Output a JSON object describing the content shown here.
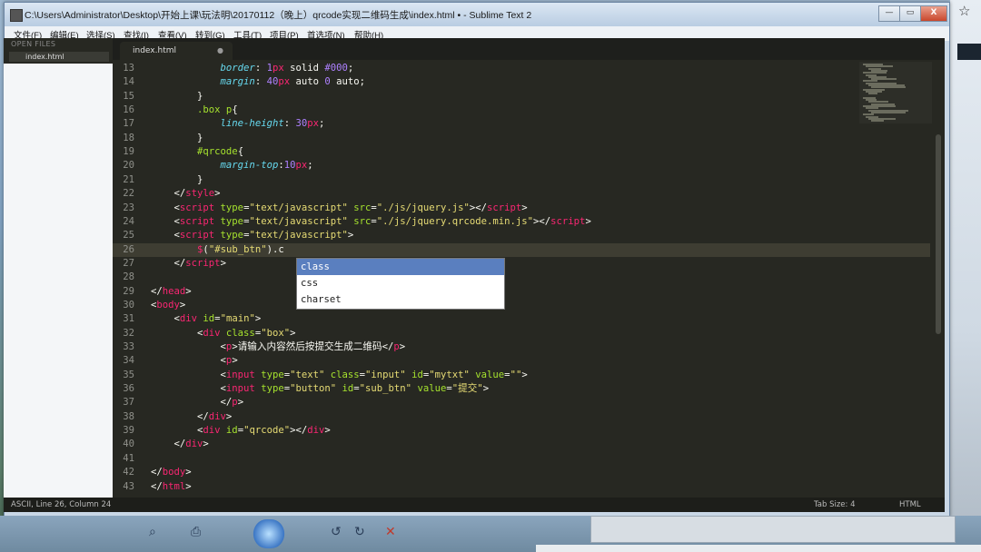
{
  "window": {
    "title": "C:\\Users\\Administrator\\Desktop\\开始上课\\玩法明\\20170112（晚上）qrcode实现二维码生成\\index.html • - Sublime Text 2",
    "controls": {
      "minimize": "—",
      "maximize": "▭",
      "close": "X"
    }
  },
  "menu": [
    "文件(F)",
    "编辑(E)",
    "选择(S)",
    "查找(I)",
    "查看(V)",
    "转到(G)",
    "工具(T)",
    "项目(P)",
    "首选项(N)",
    "帮助(H)"
  ],
  "sidebar": {
    "header": "OPEN FILES",
    "open_file": "index.html"
  },
  "editor": {
    "tab": {
      "label": "index.html",
      "dirty_icon": "●"
    },
    "current_line": 26,
    "lines": [
      {
        "n": "13",
        "tokens": [
          {
            "t": "            ",
            "c": "pun"
          },
          {
            "t": "border",
            "c": "prop"
          },
          {
            "t": ": ",
            "c": "pun"
          },
          {
            "t": "1",
            "c": "num"
          },
          {
            "t": "px",
            "c": "unit"
          },
          {
            "t": " solid ",
            "c": "text"
          },
          {
            "t": "#000",
            "c": "num"
          },
          {
            "t": ";",
            "c": "pun"
          }
        ]
      },
      {
        "n": "14",
        "tokens": [
          {
            "t": "            ",
            "c": "pun"
          },
          {
            "t": "margin",
            "c": "prop"
          },
          {
            "t": ": ",
            "c": "pun"
          },
          {
            "t": "40",
            "c": "num"
          },
          {
            "t": "px",
            "c": "unit"
          },
          {
            "t": " auto ",
            "c": "text"
          },
          {
            "t": "0",
            "c": "num"
          },
          {
            "t": " auto;",
            "c": "text"
          }
        ]
      },
      {
        "n": "15",
        "tokens": [
          {
            "t": "        }",
            "c": "pun"
          }
        ]
      },
      {
        "n": "16",
        "tokens": [
          {
            "t": "        ",
            "c": "pun"
          },
          {
            "t": ".box p",
            "c": "sel"
          },
          {
            "t": "{",
            "c": "pun"
          }
        ]
      },
      {
        "n": "17",
        "tokens": [
          {
            "t": "            ",
            "c": "pun"
          },
          {
            "t": "line-height",
            "c": "prop"
          },
          {
            "t": ": ",
            "c": "pun"
          },
          {
            "t": "30",
            "c": "num"
          },
          {
            "t": "px",
            "c": "unit"
          },
          {
            "t": ";",
            "c": "pun"
          }
        ]
      },
      {
        "n": "18",
        "tokens": [
          {
            "t": "        }",
            "c": "pun"
          }
        ]
      },
      {
        "n": "19",
        "tokens": [
          {
            "t": "        ",
            "c": "pun"
          },
          {
            "t": "#qrcode",
            "c": "sel"
          },
          {
            "t": "{",
            "c": "pun"
          }
        ]
      },
      {
        "n": "20",
        "tokens": [
          {
            "t": "            ",
            "c": "pun"
          },
          {
            "t": "margin-top",
            "c": "prop"
          },
          {
            "t": ":",
            "c": "pun"
          },
          {
            "t": "10",
            "c": "num"
          },
          {
            "t": "px",
            "c": "unit"
          },
          {
            "t": ";",
            "c": "pun"
          }
        ]
      },
      {
        "n": "21",
        "tokens": [
          {
            "t": "        }",
            "c": "pun"
          }
        ]
      },
      {
        "n": "22",
        "tokens": [
          {
            "t": "    </",
            "c": "pun"
          },
          {
            "t": "style",
            "c": "tag"
          },
          {
            "t": ">",
            "c": "pun"
          }
        ]
      },
      {
        "n": "23",
        "tokens": [
          {
            "t": "    <",
            "c": "pun"
          },
          {
            "t": "script",
            "c": "tag"
          },
          {
            "t": " type",
            "c": "attr"
          },
          {
            "t": "=",
            "c": "pun"
          },
          {
            "t": "\"text/javascript\"",
            "c": "str"
          },
          {
            "t": " src",
            "c": "attr"
          },
          {
            "t": "=",
            "c": "pun"
          },
          {
            "t": "\"./js/jquery.js\"",
            "c": "str"
          },
          {
            "t": "></",
            "c": "pun"
          },
          {
            "t": "script",
            "c": "tag"
          },
          {
            "t": ">",
            "c": "pun"
          }
        ]
      },
      {
        "n": "24",
        "tokens": [
          {
            "t": "    <",
            "c": "pun"
          },
          {
            "t": "script",
            "c": "tag"
          },
          {
            "t": " type",
            "c": "attr"
          },
          {
            "t": "=",
            "c": "pun"
          },
          {
            "t": "\"text/javascript\"",
            "c": "str"
          },
          {
            "t": " src",
            "c": "attr"
          },
          {
            "t": "=",
            "c": "pun"
          },
          {
            "t": "\"./js/jquery.qrcode.min.js\"",
            "c": "str"
          },
          {
            "t": "></",
            "c": "pun"
          },
          {
            "t": "script",
            "c": "tag"
          },
          {
            "t": ">",
            "c": "pun"
          }
        ]
      },
      {
        "n": "25",
        "tokens": [
          {
            "t": "    <",
            "c": "pun"
          },
          {
            "t": "script",
            "c": "tag"
          },
          {
            "t": " type",
            "c": "attr"
          },
          {
            "t": "=",
            "c": "pun"
          },
          {
            "t": "\"text/javascript\"",
            "c": "str"
          },
          {
            "t": ">",
            "c": "pun"
          }
        ]
      },
      {
        "n": "26",
        "tokens": [
          {
            "t": "        ",
            "c": "pun"
          },
          {
            "t": "$",
            "c": "tag"
          },
          {
            "t": "(",
            "c": "pun"
          },
          {
            "t": "\"#sub_btn\"",
            "c": "str"
          },
          {
            "t": ").c",
            "c": "pun"
          }
        ]
      },
      {
        "n": "27",
        "tokens": [
          {
            "t": "    </",
            "c": "pun"
          },
          {
            "t": "script",
            "c": "tag"
          },
          {
            "t": ">",
            "c": "pun"
          }
        ]
      },
      {
        "n": "28",
        "tokens": [
          {
            "t": "",
            "c": "pun"
          }
        ]
      },
      {
        "n": "29",
        "tokens": [
          {
            "t": "</",
            "c": "pun"
          },
          {
            "t": "head",
            "c": "tag"
          },
          {
            "t": ">",
            "c": "pun"
          }
        ]
      },
      {
        "n": "30",
        "tokens": [
          {
            "t": "<",
            "c": "pun"
          },
          {
            "t": "body",
            "c": "tag"
          },
          {
            "t": ">",
            "c": "pun"
          }
        ]
      },
      {
        "n": "31",
        "tokens": [
          {
            "t": "    <",
            "c": "pun"
          },
          {
            "t": "div",
            "c": "tag"
          },
          {
            "t": " id",
            "c": "attr"
          },
          {
            "t": "=",
            "c": "pun"
          },
          {
            "t": "\"main\"",
            "c": "str"
          },
          {
            "t": ">",
            "c": "pun"
          }
        ]
      },
      {
        "n": "32",
        "tokens": [
          {
            "t": "        <",
            "c": "pun"
          },
          {
            "t": "div",
            "c": "tag"
          },
          {
            "t": " class",
            "c": "attr"
          },
          {
            "t": "=",
            "c": "pun"
          },
          {
            "t": "\"box\"",
            "c": "str"
          },
          {
            "t": ">",
            "c": "pun"
          }
        ]
      },
      {
        "n": "33",
        "tokens": [
          {
            "t": "            <",
            "c": "pun"
          },
          {
            "t": "p",
            "c": "tag"
          },
          {
            "t": ">",
            "c": "pun"
          },
          {
            "t": "请输入内容然后按提交生成二维码",
            "c": "text"
          },
          {
            "t": "</",
            "c": "pun"
          },
          {
            "t": "p",
            "c": "tag"
          },
          {
            "t": ">",
            "c": "pun"
          }
        ]
      },
      {
        "n": "34",
        "tokens": [
          {
            "t": "            <",
            "c": "pun"
          },
          {
            "t": "p",
            "c": "tag"
          },
          {
            "t": ">",
            "c": "pun"
          }
        ]
      },
      {
        "n": "35",
        "tokens": [
          {
            "t": "            <",
            "c": "pun"
          },
          {
            "t": "input",
            "c": "tag"
          },
          {
            "t": " type",
            "c": "attr"
          },
          {
            "t": "=",
            "c": "pun"
          },
          {
            "t": "\"text\"",
            "c": "str"
          },
          {
            "t": " class",
            "c": "attr"
          },
          {
            "t": "=",
            "c": "pun"
          },
          {
            "t": "\"input\"",
            "c": "str"
          },
          {
            "t": " id",
            "c": "attr"
          },
          {
            "t": "=",
            "c": "pun"
          },
          {
            "t": "\"mytxt\"",
            "c": "str"
          },
          {
            "t": " value",
            "c": "attr"
          },
          {
            "t": "=",
            "c": "pun"
          },
          {
            "t": "\"\"",
            "c": "str"
          },
          {
            "t": ">",
            "c": "pun"
          }
        ]
      },
      {
        "n": "36",
        "tokens": [
          {
            "t": "            <",
            "c": "pun"
          },
          {
            "t": "input",
            "c": "tag"
          },
          {
            "t": " type",
            "c": "attr"
          },
          {
            "t": "=",
            "c": "pun"
          },
          {
            "t": "\"button\"",
            "c": "str"
          },
          {
            "t": " id",
            "c": "attr"
          },
          {
            "t": "=",
            "c": "pun"
          },
          {
            "t": "\"sub_btn\"",
            "c": "str"
          },
          {
            "t": " value",
            "c": "attr"
          },
          {
            "t": "=",
            "c": "pun"
          },
          {
            "t": "\"提交\"",
            "c": "str"
          },
          {
            "t": ">",
            "c": "pun"
          }
        ]
      },
      {
        "n": "37",
        "tokens": [
          {
            "t": "            </",
            "c": "pun"
          },
          {
            "t": "p",
            "c": "tag"
          },
          {
            "t": ">",
            "c": "pun"
          }
        ]
      },
      {
        "n": "38",
        "tokens": [
          {
            "t": "        </",
            "c": "pun"
          },
          {
            "t": "div",
            "c": "tag"
          },
          {
            "t": ">",
            "c": "pun"
          }
        ]
      },
      {
        "n": "39",
        "tokens": [
          {
            "t": "        <",
            "c": "pun"
          },
          {
            "t": "div",
            "c": "tag"
          },
          {
            "t": " id",
            "c": "attr"
          },
          {
            "t": "=",
            "c": "pun"
          },
          {
            "t": "\"qrcode\"",
            "c": "str"
          },
          {
            "t": "></",
            "c": "pun"
          },
          {
            "t": "div",
            "c": "tag"
          },
          {
            "t": ">",
            "c": "pun"
          }
        ]
      },
      {
        "n": "40",
        "tokens": [
          {
            "t": "    </",
            "c": "pun"
          },
          {
            "t": "div",
            "c": "tag"
          },
          {
            "t": ">",
            "c": "pun"
          }
        ]
      },
      {
        "n": "41",
        "tokens": [
          {
            "t": "",
            "c": "pun"
          }
        ]
      },
      {
        "n": "42",
        "tokens": [
          {
            "t": "</",
            "c": "pun"
          },
          {
            "t": "body",
            "c": "tag"
          },
          {
            "t": ">",
            "c": "pun"
          }
        ]
      },
      {
        "n": "43",
        "tokens": [
          {
            "t": "</",
            "c": "pun"
          },
          {
            "t": "html",
            "c": "tag"
          },
          {
            "t": ">",
            "c": "pun"
          }
        ]
      }
    ],
    "autocomplete": [
      "class",
      "css",
      "charset"
    ]
  },
  "status": {
    "left": "ASCII, Line 26, Column 24",
    "tab_size": "Tab Size: 4",
    "syntax": "HTML"
  },
  "theme": {
    "tag": "#f92672",
    "attr": "#a6e22e",
    "string": "#e6db74",
    "number": "#ae81ff",
    "background": "#272822"
  }
}
